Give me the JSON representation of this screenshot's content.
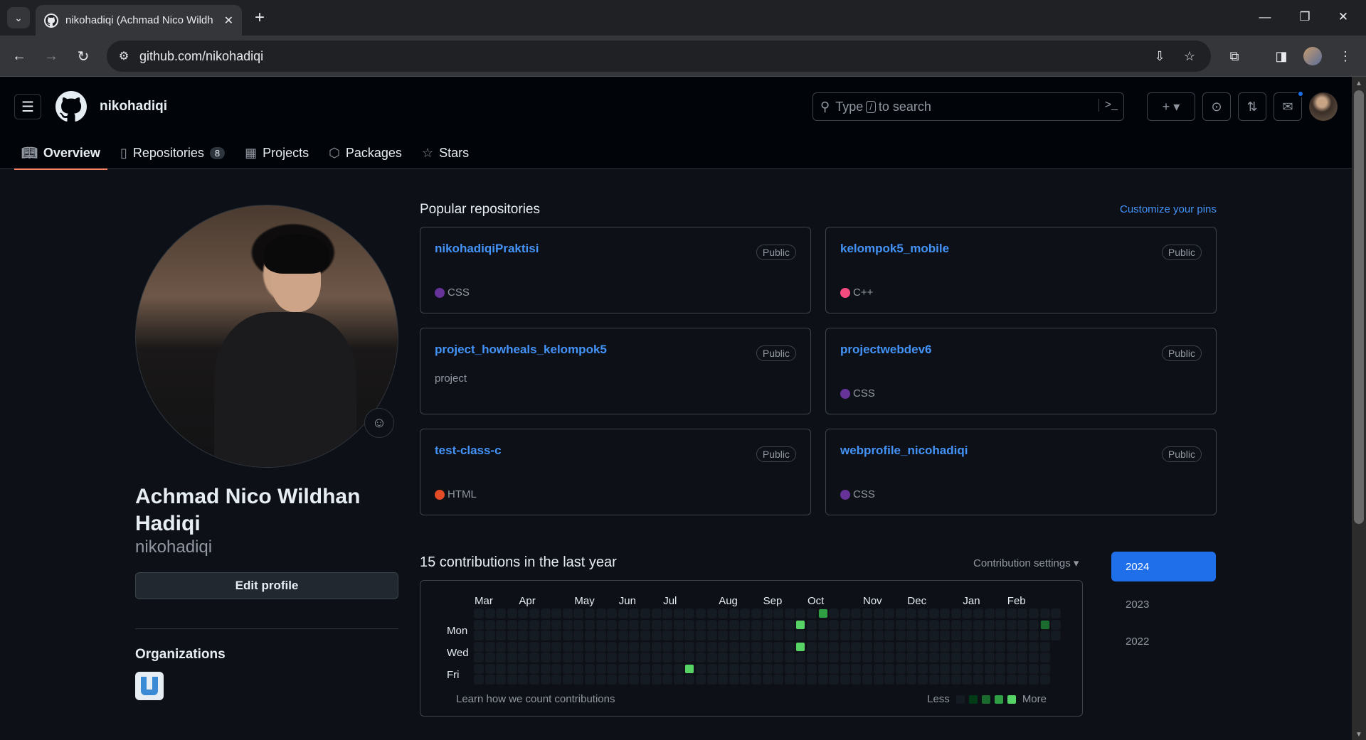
{
  "browser": {
    "tab_title": "nikohadiqi (Achmad Nico Wildh",
    "url": "github.com/nikohadiqi"
  },
  "header": {
    "username": "nikohadiqi",
    "search_prefix": "Type",
    "search_key": "/",
    "search_suffix": "to search"
  },
  "tabs": [
    {
      "label": "Overview",
      "icon": "book-icon"
    },
    {
      "label": "Repositories",
      "icon": "repo-icon",
      "count": "8"
    },
    {
      "label": "Projects",
      "icon": "table-icon"
    },
    {
      "label": "Packages",
      "icon": "package-icon"
    },
    {
      "label": "Stars",
      "icon": "star-icon"
    }
  ],
  "profile": {
    "full_name": "Achmad Nico Wildhan Hadiqi",
    "login": "nikohadiqi",
    "edit_label": "Edit profile",
    "organizations_title": "Organizations"
  },
  "popular": {
    "title": "Popular repositories",
    "customize": "Customize your pins",
    "repos": [
      {
        "name": "nikohadiqiPraktisi",
        "visibility": "Public",
        "description": "",
        "language": "CSS",
        "color": "#663399"
      },
      {
        "name": "kelompok5_mobile",
        "visibility": "Public",
        "description": "",
        "language": "C++",
        "color": "#f34b7d"
      },
      {
        "name": "project_howheals_kelompok5",
        "visibility": "Public",
        "description": "project",
        "language": "",
        "color": ""
      },
      {
        "name": "projectwebdev6",
        "visibility": "Public",
        "description": "",
        "language": "CSS",
        "color": "#663399"
      },
      {
        "name": "test-class-c",
        "visibility": "Public",
        "description": "",
        "language": "HTML",
        "color": "#e34c26"
      },
      {
        "name": "webprofile_nicohadiqi",
        "visibility": "Public",
        "description": "",
        "language": "CSS",
        "color": "#663399"
      }
    ]
  },
  "contributions": {
    "title": "15 contributions in the last year",
    "settings": "Contribution settings",
    "months": [
      "Mar",
      "Apr",
      "May",
      "Jun",
      "Jul",
      "Aug",
      "Sep",
      "Oct",
      "Nov",
      "Dec",
      "Jan",
      "Feb"
    ],
    "days": [
      "Mon",
      "Wed",
      "Fri"
    ],
    "learn": "Learn how we count contributions",
    "less": "Less",
    "more": "More",
    "levels": [
      "#151b23",
      "#033a16",
      "#196c2e",
      "#2ea043",
      "#56d364"
    ],
    "active_cells": [
      {
        "week": 19,
        "day": 5,
        "level": 4
      },
      {
        "week": 29,
        "day": 1,
        "level": 4
      },
      {
        "week": 29,
        "day": 3,
        "level": 4
      },
      {
        "week": 31,
        "day": 0,
        "level": 3
      },
      {
        "week": 51,
        "day": 1,
        "level": 2
      }
    ],
    "years": [
      "2024",
      "2023",
      "2022"
    ]
  }
}
